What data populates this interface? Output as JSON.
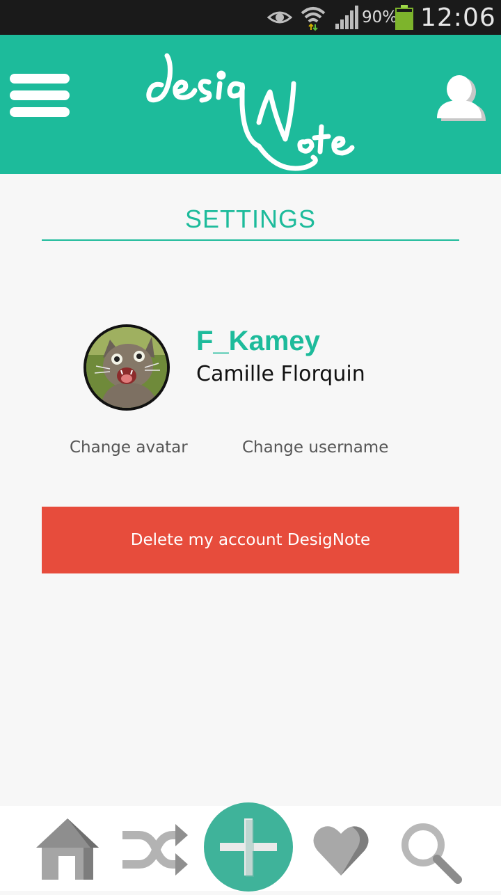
{
  "status_bar": {
    "battery_pct": "90%",
    "time": "12:06"
  },
  "header": {
    "logo_text": "desigNote",
    "icons": [
      "menu-icon",
      "user-icon"
    ]
  },
  "page": {
    "title": "SETTINGS"
  },
  "profile": {
    "username": "F_Kamey",
    "fullname": "Camille Florquin"
  },
  "actions": {
    "change_avatar": "Change avatar",
    "change_username": "Change username",
    "delete_account": "Delete my account DesigNote"
  },
  "bottom_nav": {
    "items": [
      "home-icon",
      "shuffle-icon",
      "add-icon",
      "heart-icon",
      "search-icon"
    ]
  },
  "colors": {
    "accent": "#1dbb9b",
    "danger": "#e74c3c",
    "statusbar": "#1a1a1a"
  }
}
